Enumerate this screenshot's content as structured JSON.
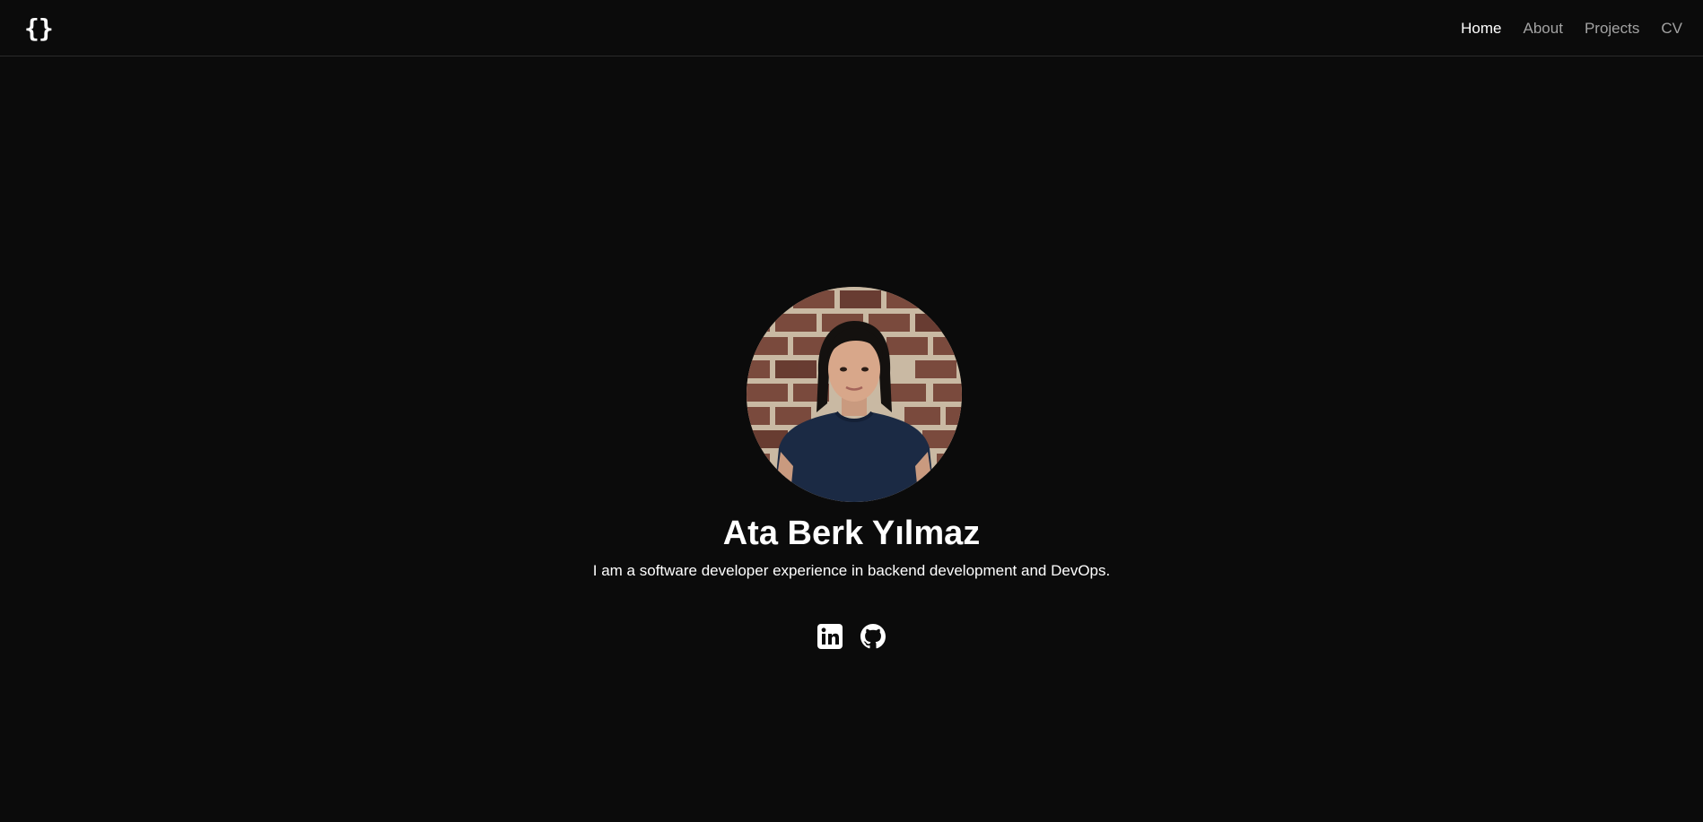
{
  "nav": {
    "logo_text": "{}",
    "links": [
      {
        "label": "Home",
        "active": true
      },
      {
        "label": "About",
        "active": false
      },
      {
        "label": "Projects",
        "active": false
      },
      {
        "label": "CV",
        "active": false
      }
    ]
  },
  "profile": {
    "name": "Ata Berk Yılmaz",
    "tagline": "I am a software developer experience in backend development and DevOps."
  },
  "socials": [
    {
      "icon": "linkedin-icon"
    },
    {
      "icon": "github-icon"
    }
  ],
  "colors": {
    "background": "#0b0b0b",
    "text": "#ffffff",
    "nav_inactive": "#a3a3a3",
    "divider": "#2a2a2a"
  }
}
